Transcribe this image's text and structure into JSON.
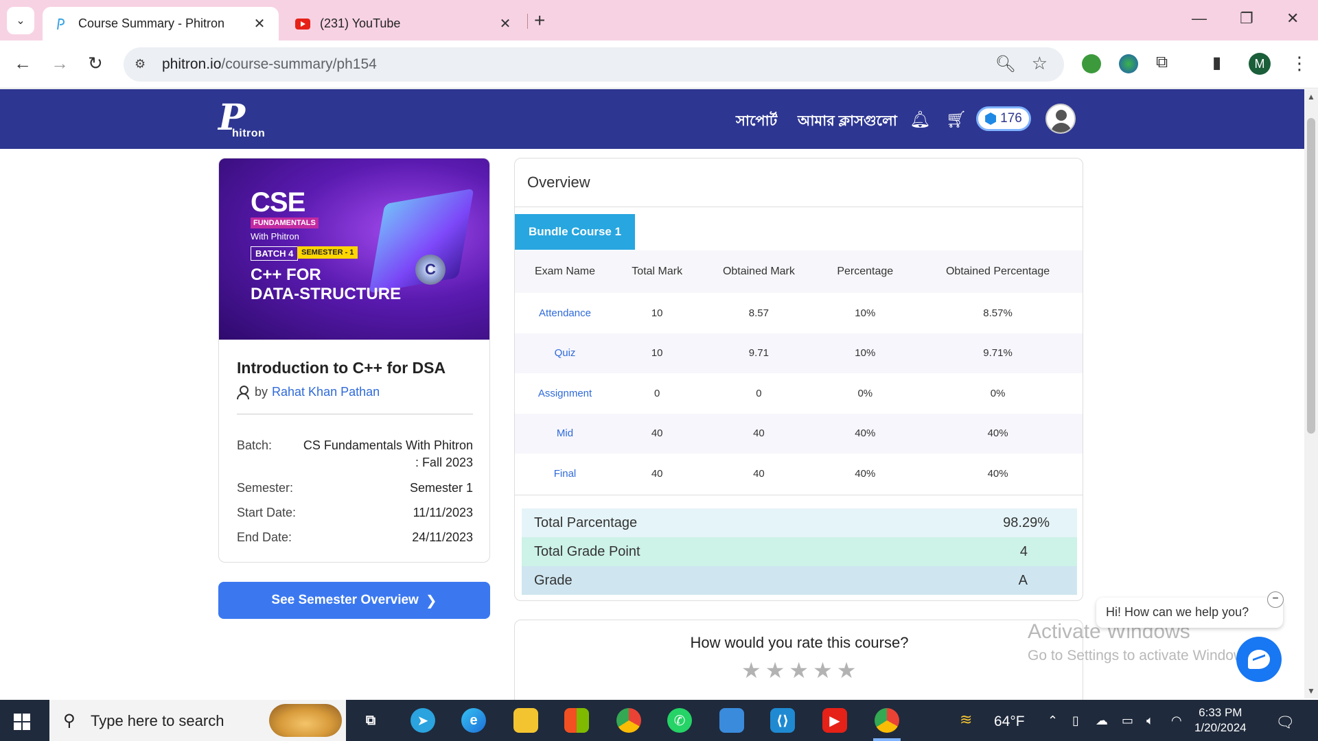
{
  "browser": {
    "tabs": [
      {
        "title": "Course Summary - Phitron",
        "active": true
      },
      {
        "title": "(231) YouTube",
        "active": false
      }
    ],
    "url_host": "phitron.io",
    "url_path": "/course-summary/ph154",
    "profile_initial": "M"
  },
  "header": {
    "logo_text": "hitron",
    "logo_letter": "P",
    "nav": [
      "সাপোর্ট",
      "আমার ক্লাসগুলো"
    ],
    "coins": "176"
  },
  "course": {
    "banner": {
      "headline": "CSE",
      "tag": "FUNDAMENTALS",
      "with": "With Phitron",
      "batch": "BATCH 4",
      "semester": "SEMESTER - 1",
      "line1": "C++ FOR",
      "line2": "DATA-STRUCTURE",
      "orb": "C"
    },
    "title": "Introduction to C++ for DSA",
    "by": "by",
    "author": "Rahat Khan Pathan",
    "meta": {
      "batch_label": "Batch:",
      "batch_value_1": "CS Fundamentals With Phitron",
      "batch_value_2": ": Fall 2023",
      "semester_label": "Semester:",
      "semester_value": "Semester 1",
      "start_label": "Start Date:",
      "start_value": "11/11/2023",
      "end_label": "End Date:",
      "end_value": "24/11/2023"
    },
    "semester_button": "See Semester Overview"
  },
  "overview": {
    "title": "Overview",
    "bundle_tab": "Bundle Course 1",
    "columns": [
      "Exam Name",
      "Total Mark",
      "Obtained Mark",
      "Percentage",
      "Obtained Percentage"
    ],
    "rows": [
      [
        "Attendance",
        "10",
        "8.57",
        "10%",
        "8.57%"
      ],
      [
        "Quiz",
        "10",
        "9.71",
        "10%",
        "9.71%"
      ],
      [
        "Assignment",
        "0",
        "0",
        "0%",
        "0%"
      ],
      [
        "Mid",
        "40",
        "40",
        "40%",
        "40%"
      ],
      [
        "Final",
        "40",
        "40",
        "40%",
        "40%"
      ]
    ],
    "summary": {
      "total_percentage_label": "Total Parcentage",
      "total_percentage_value": "98.29%",
      "grade_point_label": "Total Grade Point",
      "grade_point_value": "4",
      "grade_label": "Grade",
      "grade_value": "A"
    }
  },
  "rating": {
    "question": "How would you rate this course?",
    "stars": 5
  },
  "chat": {
    "greeting": "Hi! How can we help you?"
  },
  "watermark": {
    "line1": "Activate Windows",
    "line2": "Go to Settings to activate Windows."
  },
  "taskbar": {
    "search_placeholder": "Type here to search",
    "temperature": "64°F",
    "time": "6:33 PM",
    "date": "1/20/2024"
  },
  "colors": {
    "header_bg": "#2d3691",
    "primary_button": "#3b78f0",
    "bundle_tab": "#27a6e0",
    "link": "#2f6ad9"
  }
}
